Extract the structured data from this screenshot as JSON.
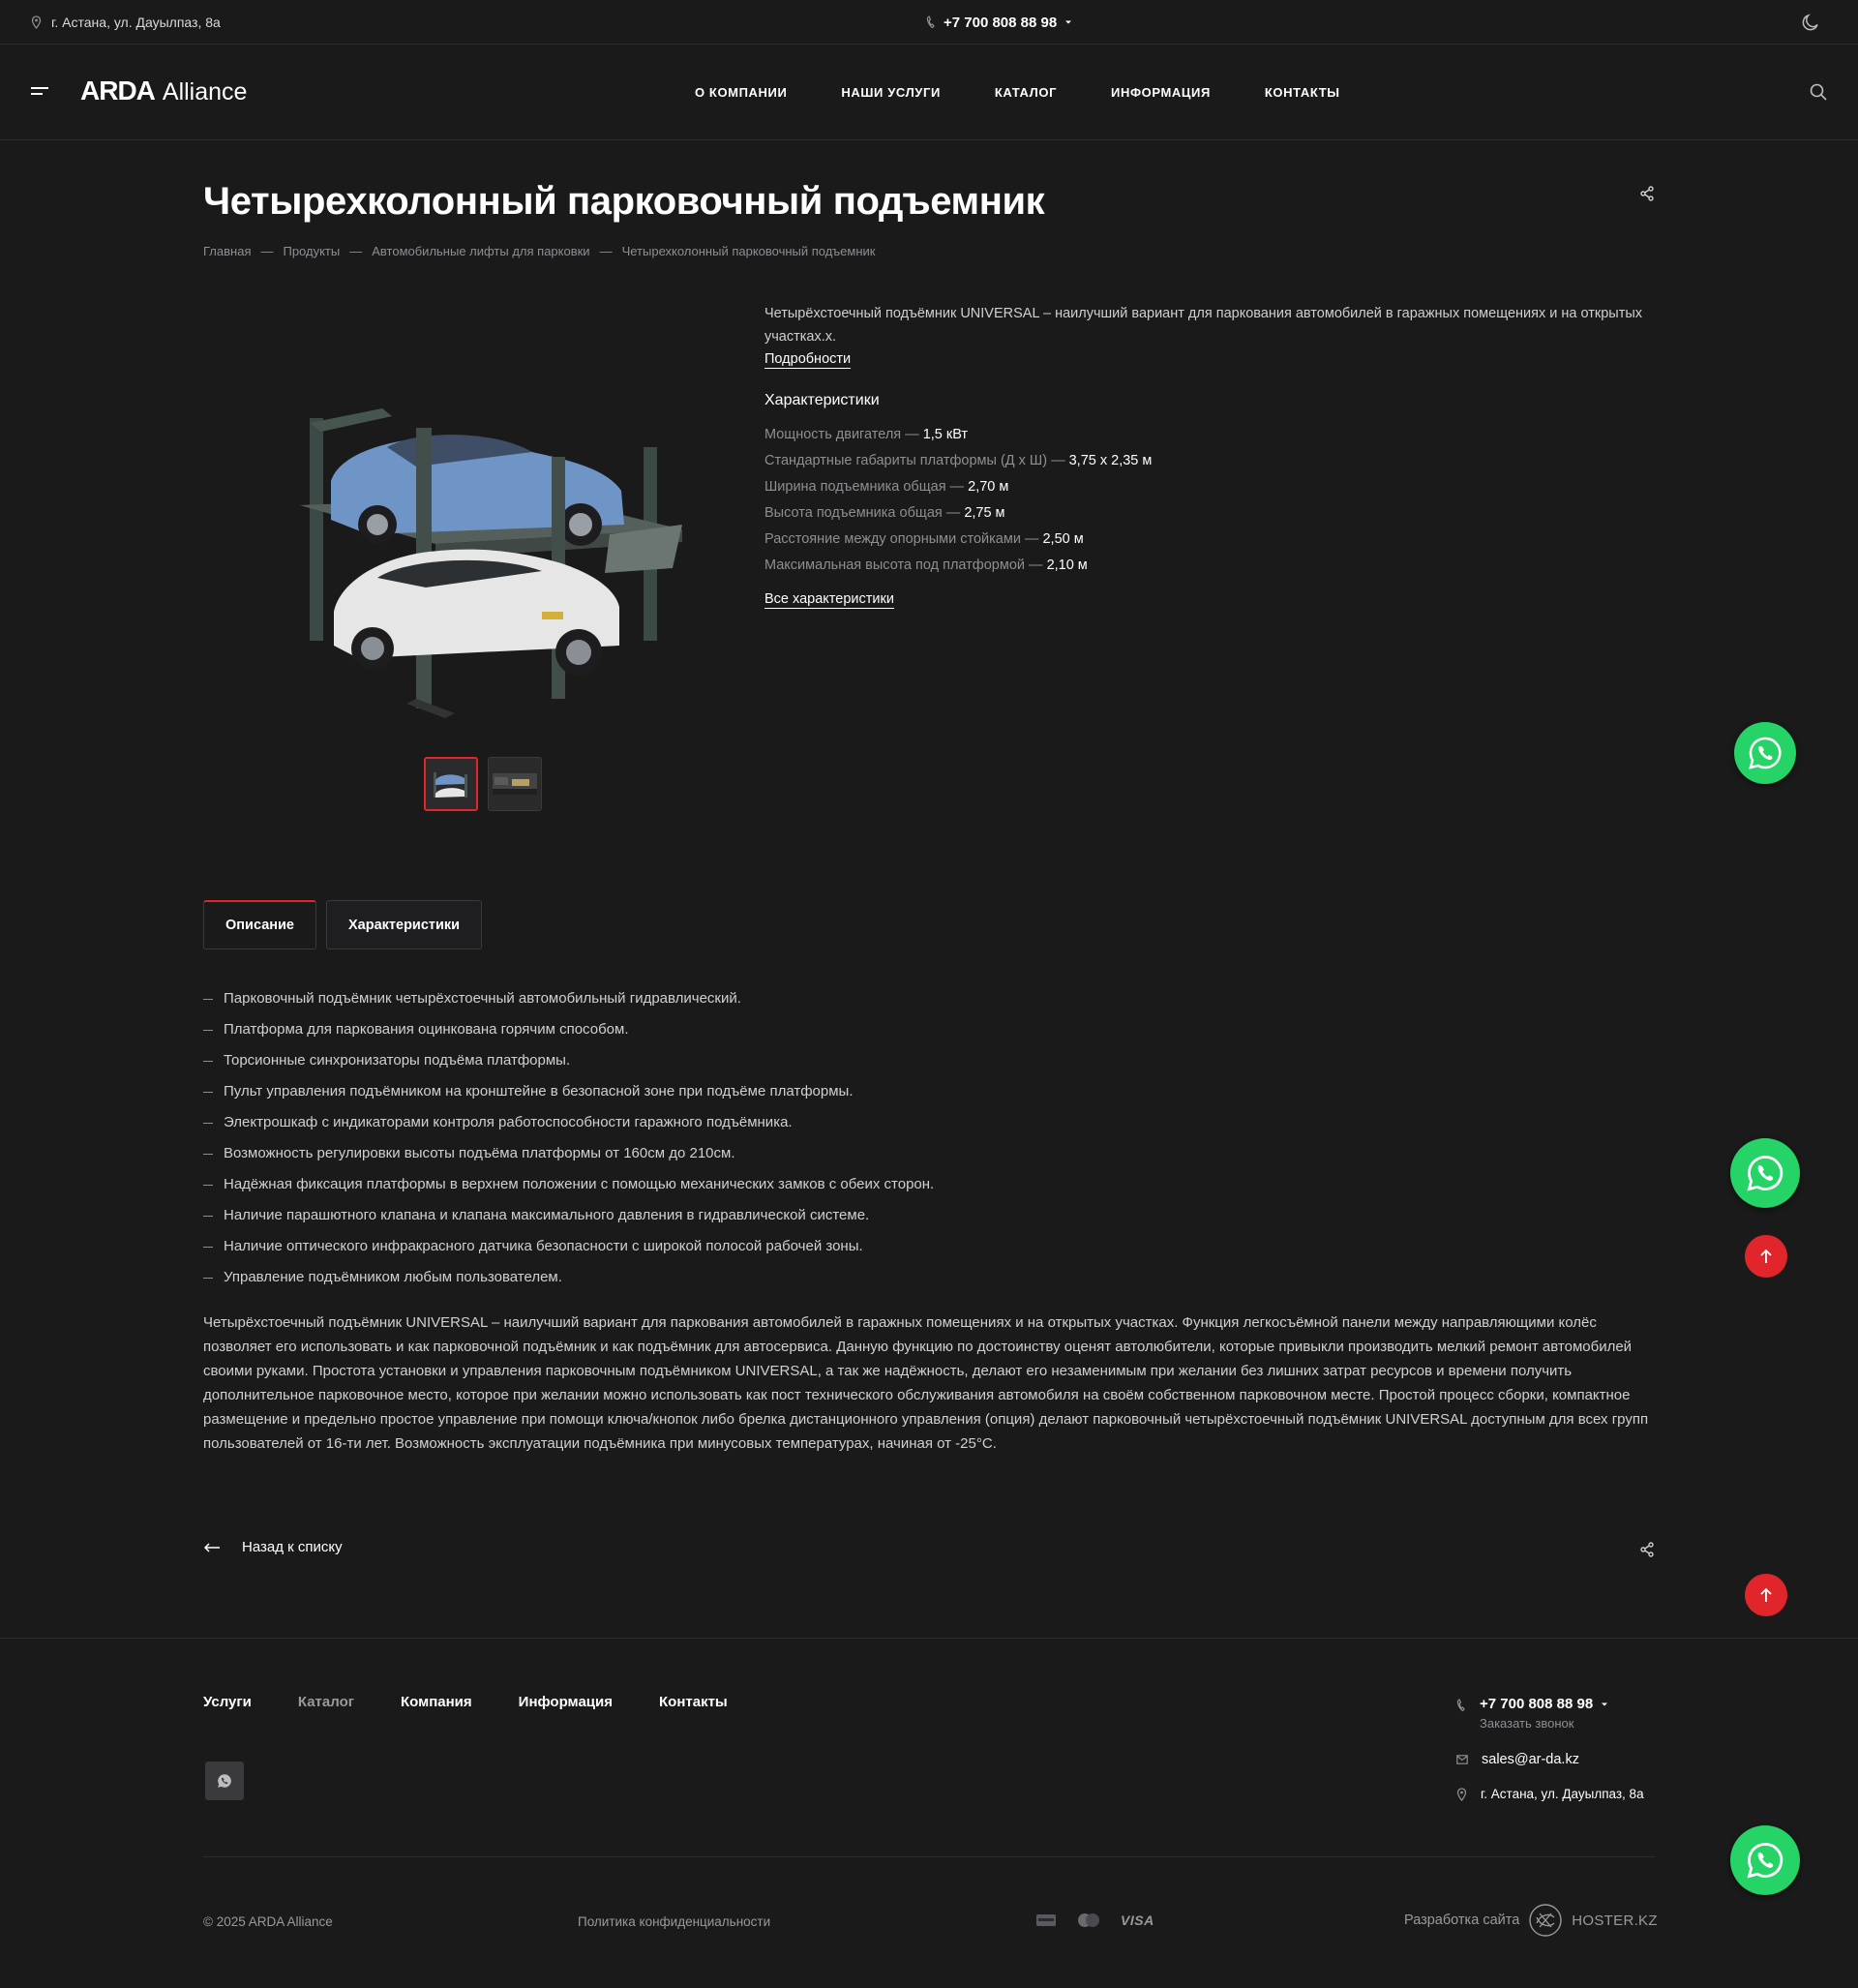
{
  "topbar": {
    "address": "г. Астана, ул. Дауылпаз, 8а",
    "phone": "+7 700 808 88 98"
  },
  "header": {
    "logo_part1": "ARDA",
    "logo_part2": "Alliance",
    "nav": [
      "О КОМПАНИИ",
      "НАШИ УСЛУГИ",
      "КАТАЛОГ",
      "ИНФОРМАЦИЯ",
      "КОНТАКТЫ"
    ]
  },
  "page": {
    "title": "Четырехколонный парковочный подъемник",
    "breadcrumbs": [
      "Главная",
      "Продукты",
      "Автомобильные лифты для парковки",
      "Четырехколонный парковочный подъемник"
    ],
    "breadcrumb_separator": "—"
  },
  "product": {
    "intro": "Четырёхстоечный подъёмник UNIVERSAL – наилучший вариант для паркования   автомобилей в гаражных помещениях и на открытых участках.х.",
    "details_link": "Подробности",
    "chars_title": "Характеристики",
    "chars": [
      {
        "label": "Мощность двигателя",
        "value": "1,5 кВт"
      },
      {
        "label": "Стандартные габариты платформы (Д х Ш)",
        "value": "3,75 х 2,35 м"
      },
      {
        "label": "Ширина подъемника общая",
        "value": "2,70 м"
      },
      {
        "label": "Высота подъемника общая",
        "value": "2,75 м"
      },
      {
        "label": "Расстояние между опорными стойками",
        "value": "2,50 м"
      },
      {
        "label": "Максимальная высота под платформой",
        "value": "2,10 м"
      }
    ],
    "char_separator": " — ",
    "all_chars_link": "Все характеристики"
  },
  "tabs": [
    {
      "label": "Описание",
      "active": true
    },
    {
      "label": "Характеристики",
      "active": false
    }
  ],
  "description": {
    "items": [
      "Парковочный подъёмник четырёхстоечный автомобильный гидравлический.",
      "Платформа для паркования оцинкована горячим способом.",
      "Торсионные синхронизаторы подъёма платформы.",
      "Пульт управления подъёмником на кронштейне в безопасной зоне при подъёме платформы.",
      "Электрошкаф с индикаторами контроля работоспособности гаражного подъёмника.",
      "Возможность регулировки высоты подъёма платформы от 160см до 210см.",
      "Надёжная фиксация платформы в верхнем положении с помощью механических замков с обеих сторон.",
      "Наличие парашютного клапана и клапана максимального давления в гидравлической системе.",
      "Наличие оптического инфракрасного датчика безопасности с широкой полосой рабочей зоны.",
      "Управление подъёмником любым пользователем."
    ],
    "paragraph": "Четырёхстоечный подъёмник UNIVERSAL – наилучший вариант для паркования   автомобилей в гаражных помещениях и на открытых участках. Функция легкосъёмной панели между направляющими колёс позволяет его использовать и как парковочной подъёмник и как подъёмник для автосервиса. Данную функцию по достоинству оценят автолюбители, которые привыкли производить мелкий ремонт автомобилей своими руками. Простота установки и управления парковочным подъёмником UNIVERSAL, а так же надёжность, делают его незаменимым при желании без лишних затрат ресурсов и времени получить дополнительное парковочное место, которое при желании можно использовать как пост технического обслуживания автомобиля на своём собственном парковочном месте. Простой процесс сборки, компактное размещение и предельно простое управление при помощи ключа/кнопок либо брелка дистанционного управления (опция) делают парковочный четырёхстоечный подъёмник UNIVERSAL доступным для всех групп пользователей от 16-ти лет. Возможность эксплуатации подъёмника при минусовых температурах, начиная от -25°C."
  },
  "back_link": "Назад к списку",
  "footer": {
    "nav": [
      "Услуги",
      "Каталог",
      "Компания",
      "Информация",
      "Контакты"
    ],
    "phone": "+7 700 808 88 98",
    "callback": "Заказать звонок",
    "email": "sales@ar-da.kz",
    "address": "г. Астана, ул. Дауылпаз, 8а",
    "copyright": "© 2025 ARDA Alliance",
    "policy": "Политика конфиденциальности",
    "visa": "VISA",
    "dev_label": "Разработка сайта",
    "dev_brand": "HOSTER.KZ"
  },
  "colors": {
    "background": "#1a1a1b",
    "accent": "#e0262b",
    "whatsapp": "#25d366"
  }
}
